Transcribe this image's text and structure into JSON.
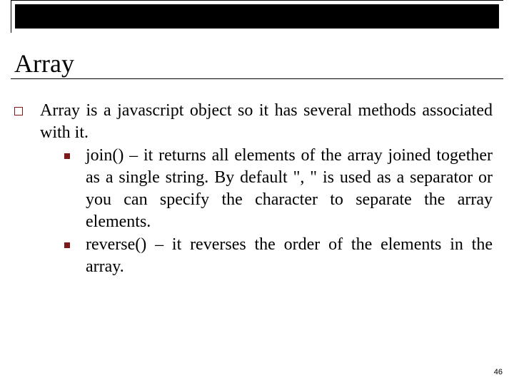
{
  "title": "Array",
  "body": {
    "intro": "Array is a javascript object so it has several methods associated with it.",
    "items": [
      "join() – it returns all elements of the array joined together as a single string. By default \", \" is used as a separator or you can specify the character to separate the array elements.",
      "reverse() – it reverses the order of the elements in the array."
    ]
  },
  "page_number": "46"
}
